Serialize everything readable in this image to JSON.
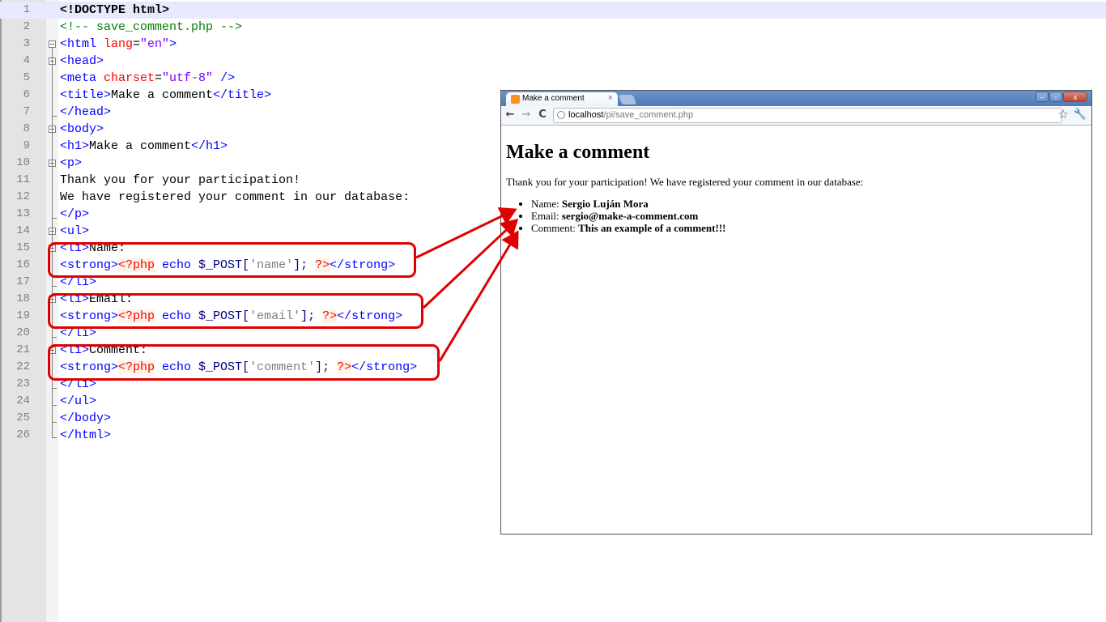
{
  "editor": {
    "file_comment": "save_comment.php",
    "lines": [
      {
        "n": "1"
      },
      {
        "n": "2"
      },
      {
        "n": "3"
      },
      {
        "n": "4"
      },
      {
        "n": "5"
      },
      {
        "n": "6"
      },
      {
        "n": "7"
      },
      {
        "n": "8"
      },
      {
        "n": "9"
      },
      {
        "n": "10"
      },
      {
        "n": "11"
      },
      {
        "n": "12"
      },
      {
        "n": "13"
      },
      {
        "n": "14"
      },
      {
        "n": "15"
      },
      {
        "n": "16"
      },
      {
        "n": "17"
      },
      {
        "n": "18"
      },
      {
        "n": "19"
      },
      {
        "n": "20"
      },
      {
        "n": "21"
      },
      {
        "n": "22"
      },
      {
        "n": "23"
      },
      {
        "n": "24"
      },
      {
        "n": "25"
      },
      {
        "n": "26"
      }
    ],
    "code": {
      "l1": "<!DOCTYPE html>",
      "l2": "<!-- save_comment.php -->",
      "l3_tag": "<html ",
      "l3_attr": "lang",
      "l3_eq": "=",
      "l3_val": "\"en\"",
      "l3_end": ">",
      "l4": "<head>",
      "l5_tag": "<meta ",
      "l5_attr": "charset",
      "l5_eq": "=",
      "l5_val": "\"utf-8\"",
      "l5_end": " />",
      "l6_open": "<title>",
      "l6_text": "Make a comment",
      "l6_close": "</title>",
      "l7": "</head>",
      "l8": "<body>",
      "l9_open": "<h1>",
      "l9_text": "Make a comment",
      "l9_close": "</h1>",
      "l10": "<p>",
      "l11": "Thank you for your participation!",
      "l12": "We have registered your comment in our database:",
      "l13": "</p>",
      "l14": "<ul>",
      "l15_open": "<li>",
      "l15_text": "Name:",
      "l16_strong": "<strong>",
      "l16_php_open": "<?php",
      "l16_echo": " echo",
      "l16_var": " $_POST[",
      "l16_str": "'name'",
      "l16_end": "]; ",
      "l16_php_close": "?>",
      "l16_strong_close": "</strong>",
      "l17": "</li>",
      "l18_open": "<li>",
      "l18_text": "Email:",
      "l19_str": "'email'",
      "l20": "</li>",
      "l21_open": "<li>",
      "l21_text": "Comment:",
      "l22_str": "'comment'",
      "l23": "</li>",
      "l24": "</ul>",
      "l25": "</body>",
      "l26": "</html>"
    }
  },
  "browser": {
    "tab_title": "Make a comment",
    "tab_close": "×",
    "url_host": "localhost",
    "url_path": "/pi/save_comment.php",
    "win_min": "–",
    "win_max": "▫",
    "win_close": "x",
    "back": "←",
    "forward": "→",
    "reload": "C",
    "star": "☆",
    "wrench": "🔧",
    "page": {
      "heading": "Make a comment",
      "paragraph": "Thank you for your participation! We have registered your comment in our database:",
      "items": [
        {
          "label": "Name: ",
          "value": "Sergio Luján Mora"
        },
        {
          "label": "Email: ",
          "value": "sergio@make-a-comment.com"
        },
        {
          "label": "Comment: ",
          "value": "This an example of a comment!!!"
        }
      ]
    }
  },
  "colors": {
    "annotation_red": "#e00000",
    "tag_blue": "#0000ff",
    "attr_red": "#ff0000",
    "value_purple": "#8000ff",
    "comment_green": "#008000"
  }
}
